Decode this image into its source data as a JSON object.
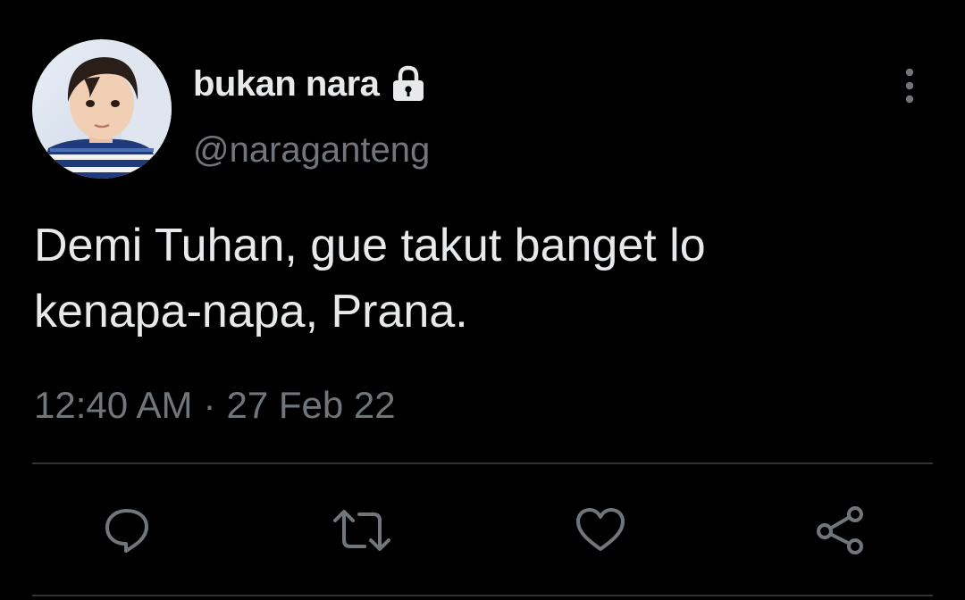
{
  "tweet": {
    "display_name": "bukan nara",
    "handle": "@naraganteng",
    "text_line1": "Demi Tuhan, gue takut banget lo",
    "text_line2": "kenapa-napa, Prana.",
    "time": "12:40 AM",
    "separator": "·",
    "date": "27 Feb 22",
    "protected_icon": "lock-icon",
    "avatar_alt": "avatar"
  },
  "actions": [
    {
      "name": "reply",
      "icon": "comment-icon"
    },
    {
      "name": "retweet",
      "icon": "retweet-icon"
    },
    {
      "name": "like",
      "icon": "heart-icon"
    },
    {
      "name": "share",
      "icon": "share-icon"
    }
  ],
  "colors": {
    "background": "#000000",
    "primary_text": "#e7e9ea",
    "secondary_text": "#71767b",
    "divider": "#2f3336",
    "icon": "#71767b"
  }
}
